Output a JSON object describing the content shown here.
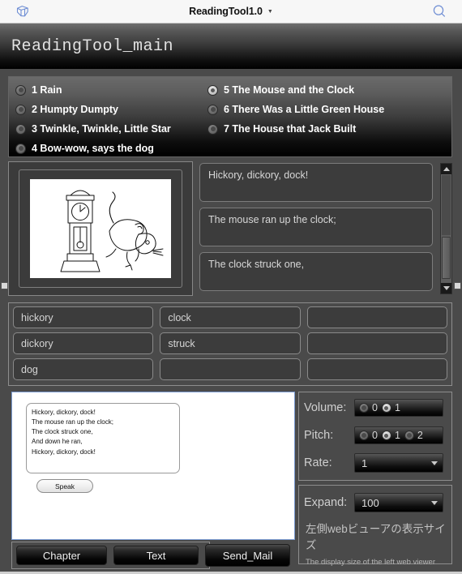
{
  "browser_bar": {
    "left_icon": "pages-folder-icon",
    "title": "ReadingTool1.0",
    "caret": "▼",
    "right_icon": "search-icon"
  },
  "page": {
    "title": "ReadingTool_main"
  },
  "story_list": {
    "column_left": [
      {
        "num_label": "1 Rain",
        "selected": false
      },
      {
        "num_label": "2 Humpty Dumpty",
        "selected": false
      },
      {
        "num_label": "3 Twinkle, Twinkle, Little Star",
        "selected": false
      },
      {
        "num_label": "4 Bow-wow, says the dog",
        "selected": false
      }
    ],
    "column_right": [
      {
        "num_label": "5 The Mouse and the Clock",
        "selected": true
      },
      {
        "num_label": "6 There Was a Little Green House",
        "selected": false
      },
      {
        "num_label": "7 The House that Jack Built",
        "selected": false
      }
    ]
  },
  "illustration": {
    "alt": "grandfather-clock-and-mouse-line-drawing"
  },
  "sentence_panel": {
    "lines": [
      "Hickory, dickory, dock!",
      "The mouse ran up the clock;",
      "The clock struck one,"
    ],
    "scroll_up": "▲",
    "scroll_down": "▼"
  },
  "word_grid": {
    "rows": [
      [
        "hickory",
        "clock",
        ""
      ],
      [
        "dickory",
        "struck",
        ""
      ],
      [
        "dog",
        "",
        ""
      ]
    ]
  },
  "speak_panel": {
    "text": "Hickory, dickory, dock!\nThe mouse ran up the clock;\nThe clock struck one,\nAnd down he ran,\nHickory, dickory, dock!",
    "button_label": "Speak"
  },
  "controls": {
    "volume": {
      "label": "Volume:",
      "options": [
        "0",
        "1"
      ],
      "selected": "1"
    },
    "pitch": {
      "label": "Pitch:",
      "options": [
        "0",
        "1",
        "2"
      ],
      "selected": "1"
    },
    "rate": {
      "label": "Rate:",
      "value": "1",
      "caret": "▼"
    }
  },
  "expand": {
    "label": "Expand:",
    "value": "100",
    "caret": "▼",
    "note_jp": "左側webビューアの表示サイズ",
    "note_en": "The display size of the left web viewer"
  },
  "bottom_buttons": {
    "chapter": "Chapter",
    "text": "Text",
    "send_mail": "Send_Mail"
  },
  "colors": {
    "window_bg": "#4a4a4a",
    "accent_blue": "#6f8ed4",
    "panel_dark": "#3c3c3c",
    "text_light": "#d5d5d5"
  }
}
